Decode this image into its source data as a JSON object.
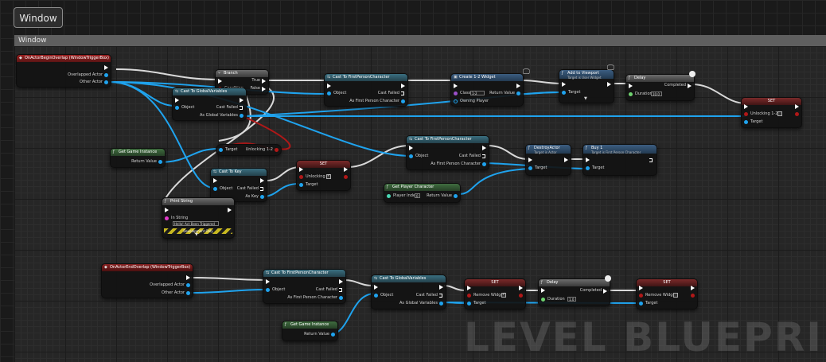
{
  "tab_chip": "Window",
  "window_title": "Window",
  "watermark": "LEVEL BLUEPRINT",
  "colors": {
    "exec_wire": "#d9d9d9",
    "object_wire": "#1fa3ee",
    "bool_wire": "#b01818"
  },
  "nodes": {
    "begin_overlap": {
      "title": "OnActorBeginOverlap (WindowTriggerBox)",
      "pin1": "Overlapped Actor",
      "pin2": "Other Actor"
    },
    "branch": {
      "title": "Branch",
      "condition": "Condition",
      "true": "True",
      "false": "False"
    },
    "cast_global": {
      "title": "Cast To GlobalVariables",
      "object": "Object",
      "cast_failed": "Cast Failed",
      "as": "As Global Variables"
    },
    "cast_fp_1": {
      "title": "Cast To FirstPersonCharacter",
      "object": "Object",
      "cast_failed": "Cast Failed",
      "as": "As First Person Character"
    },
    "create_widget": {
      "title": "Create 1-2 Widget",
      "class": "Class",
      "class_value": "1-2",
      "owning": "Owning Player",
      "return": "Return Value"
    },
    "add_viewport": {
      "title": "Add to Viewport",
      "subtitle": "Target is User Widget",
      "target": "Target"
    },
    "delay_1": {
      "title": "Delay",
      "completed": "Completed",
      "duration": "Duration",
      "duration_value": "10.0"
    },
    "set_unlocking": {
      "title": "SET",
      "field": "Unlocking 1-2",
      "target": "Target"
    },
    "target_getter": {
      "target": "Target",
      "field": "Unlocking 1-2"
    },
    "get_game_instance_1": {
      "title": "Get Game Instance",
      "return": "Return Value"
    },
    "cast_fp_2": {
      "title": "Cast To FirstPersonCharacter",
      "object": "Object",
      "cast_failed": "Cast Failed",
      "as": "As First Person Character"
    },
    "destroy_actor": {
      "title": "DestroyActor",
      "subtitle": "Target is Actor",
      "target": "Target"
    },
    "buy": {
      "title": "Buy 1",
      "subtitle": "Target is First Person Character",
      "target": "Target"
    },
    "cast_key": {
      "title": "Cast To Key",
      "object": "Object",
      "cast_failed": "Cast Failed",
      "as": "As Key"
    },
    "set_unlocking_2": {
      "title": "SET",
      "field": "Unlocking",
      "target": "Target"
    },
    "get_player_character": {
      "title": "Get Player Character",
      "player_index": "Player Index",
      "player_index_value": "0",
      "return": "Return Value"
    },
    "print_string": {
      "title": "Print String",
      "in_string": "In String",
      "value": "Hello! Act Been Triggered",
      "dev": "Development Only"
    },
    "end_overlap": {
      "title": "OnActorEndOverlap (WindowTriggerBox)",
      "pin1": "Overlapped Actor",
      "pin2": "Other Actor"
    },
    "cast_fp_3": {
      "title": "Cast To FirstPersonCharacter",
      "object": "Object",
      "cast_failed": "Cast Failed",
      "as": "As First Person Character"
    },
    "cast_global_2": {
      "title": "Cast To GlobalVariables",
      "object": "Object",
      "cast_failed": "Cast Failed",
      "as": "As Global Variables"
    },
    "set_remove_1": {
      "title": "SET",
      "field": "Remove Widget",
      "target": "Target"
    },
    "delay_2": {
      "title": "Delay",
      "completed": "Completed",
      "duration": "Duration",
      "duration_value": "1.0"
    },
    "set_remove_2": {
      "title": "SET",
      "field": "Remove Widget",
      "target": "Target"
    },
    "get_game_instance_2": {
      "title": "Get Game Instance",
      "return": "Return Value"
    }
  }
}
